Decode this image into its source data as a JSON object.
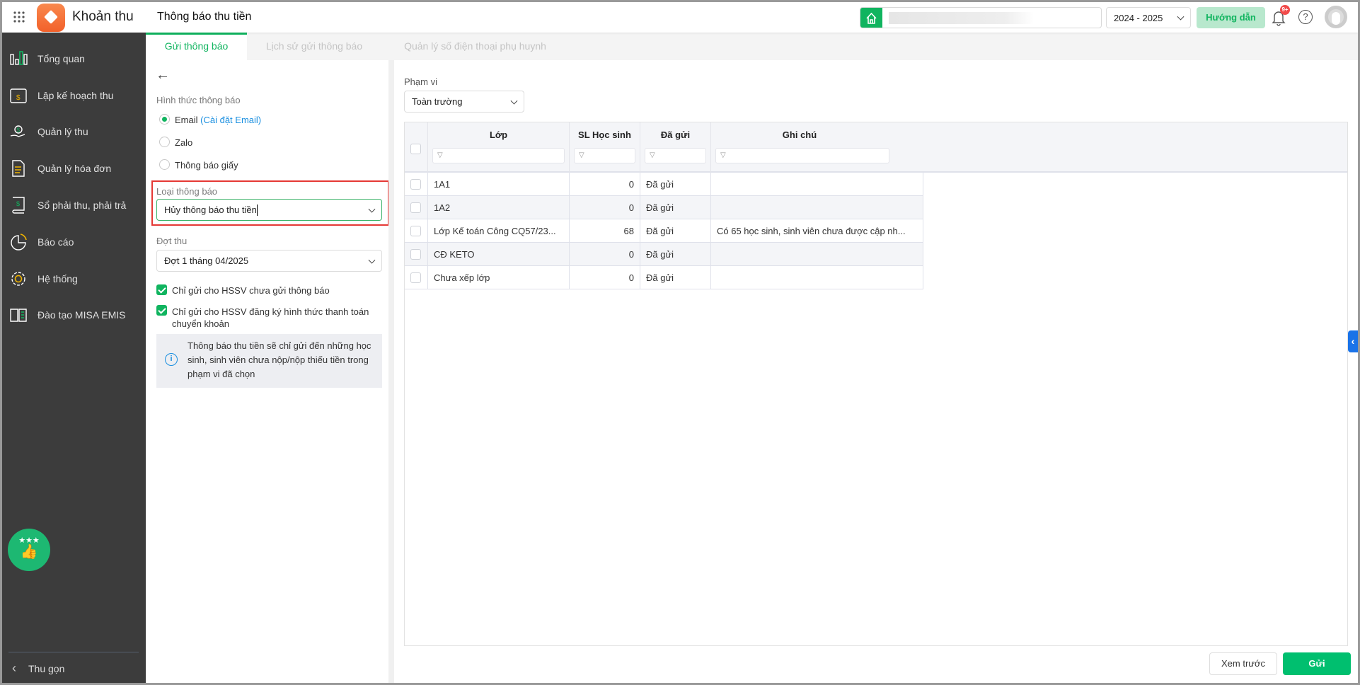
{
  "header": {
    "app_name": "Khoản thu",
    "page_title": "Thông báo thu tiền",
    "school_year": "2024 - 2025",
    "guide_button": "Hướng dẫn",
    "notification_badge": "9+"
  },
  "sidebar": {
    "items": [
      {
        "label": "Tổng quan",
        "icon": "bar-chart-icon"
      },
      {
        "label": "Lập kế hoạch thu",
        "icon": "calendar-dollar-icon"
      },
      {
        "label": "Quản lý thu",
        "icon": "hand-coin-icon"
      },
      {
        "label": "Quản lý hóa đơn",
        "icon": "invoice-icon"
      },
      {
        "label": "Sổ phải thu, phải trả",
        "icon": "ledger-icon"
      },
      {
        "label": "Báo cáo",
        "icon": "pie-chart-icon"
      },
      {
        "label": "Hệ thống",
        "icon": "gear-icon"
      },
      {
        "label": "Đào tạo MISA EMIS",
        "icon": "book-icon"
      }
    ],
    "collapse_label": "Thu gọn"
  },
  "tabs": [
    {
      "label": "Gửi thông báo",
      "active": true
    },
    {
      "label": "Lịch sử gửi thông báo"
    },
    {
      "label": "Quản lý số điện thoại phụ huynh"
    }
  ],
  "form": {
    "method_label": "Hình thức thông báo",
    "methods": [
      {
        "label": "Email",
        "link": "(Cài đặt Email)",
        "selected": true
      },
      {
        "label": "Zalo"
      },
      {
        "label": "Thông báo giấy"
      }
    ],
    "type_label": "Loại thông báo",
    "type_value": "Hủy thông báo thu tiền",
    "period_label": "Đợt thu",
    "period_value": "Đợt 1 tháng 04/2025",
    "checks": [
      {
        "label": "Chỉ gửi cho HSSV chưa gửi thông báo",
        "checked": true
      },
      {
        "label": "Chỉ gửi cho HSSV đăng ký hình thức thanh toán chuyển khoản",
        "checked": true
      }
    ],
    "info": "Thông báo thu tiền sẽ chỉ gửi đến những học sinh, sinh viên chưa nộp/nộp thiếu tiền trong phạm vi đã chọn"
  },
  "scope": {
    "label": "Phạm vi",
    "value": "Toàn trường"
  },
  "table": {
    "columns": [
      "Lớp",
      "SL Học sinh",
      "Đã gửi",
      "Ghi chú"
    ],
    "rows": [
      {
        "class": "1A1",
        "count": "0",
        "sent": "Đã gửi",
        "note": ""
      },
      {
        "class": "1A2",
        "count": "0",
        "sent": "Đã gửi",
        "note": ""
      },
      {
        "class": "Lớp Kế toán Công CQ57/23...",
        "count": "68",
        "sent": "Đã gửi",
        "note": "Có 65 học sinh, sinh viên chưa được cập nh..."
      },
      {
        "class": "CĐ KETO",
        "count": "0",
        "sent": "Đã gửi",
        "note": ""
      },
      {
        "class": "Chưa xếp lớp",
        "count": "0",
        "sent": "Đã gửi",
        "note": ""
      }
    ]
  },
  "footer": {
    "preview_button": "Xem trước",
    "send_button": "Gửi"
  },
  "colors": {
    "accent": "#10b45f",
    "sidebar": "#3c3c3c",
    "highlight": "#e53935"
  }
}
